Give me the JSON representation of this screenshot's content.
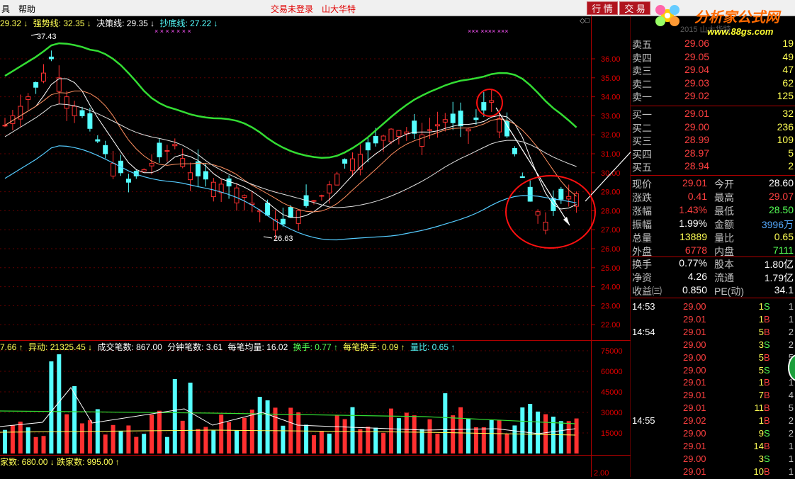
{
  "menubar": {
    "items": [
      "具",
      "帮助"
    ],
    "status_left": "交易未登录",
    "status_right": "山大华特",
    "buttons": [
      "行 情",
      "交 易"
    ]
  },
  "logo": {
    "title": "分析家公式网",
    "url": "www.88gs.com",
    "faded": "2015 山大华特"
  },
  "main_header": {
    "first": "29.32 ↓",
    "strong_label": "强势线: 32.35 ↓",
    "decide_label": "决策线: 29.35 ↓",
    "bottom_label": "抄底线: 27.22 ↓"
  },
  "price_axis": [
    "36.00",
    "35.00",
    "34.00",
    "33.00",
    "32.00",
    "31.00",
    "30.00",
    "29.00",
    "28.00",
    "27.00",
    "26.00",
    "25.00",
    "24.00",
    "23.00",
    "22.00"
  ],
  "price_marks": {
    "high": "37.43",
    "low": "26.63"
  },
  "volume_header": {
    "first": "7.66 ↑",
    "yidong": "异动: 21325.45 ↓",
    "trades": "成交笔数: 867.00",
    "per_min": "分钟笔数: 3.61",
    "avg": "每笔均量: 16.02",
    "turnover": "换手: 0.77 ↑",
    "per_turnover": "每笔换手: 0.09 ↑",
    "ratio": "量比: 0.65 ↑"
  },
  "volume_axis": [
    "75000",
    "60000",
    "45000",
    "30000",
    "15000"
  ],
  "bottom_header": {
    "up": "家数: 680.00 ↓",
    "down": "跌家数: 995.00 ↑"
  },
  "bottom_axis": "2.00",
  "order_book": {
    "sell": [
      {
        "label": "卖五",
        "price": "29.06",
        "vol": "19"
      },
      {
        "label": "卖四",
        "price": "29.05",
        "vol": "49"
      },
      {
        "label": "卖三",
        "price": "29.04",
        "vol": "47"
      },
      {
        "label": "卖二",
        "price": "29.03",
        "vol": "62"
      },
      {
        "label": "卖一",
        "price": "29.02",
        "vol": "125"
      }
    ],
    "buy": [
      {
        "label": "买一",
        "price": "29.01",
        "vol": "32"
      },
      {
        "label": "买二",
        "price": "29.00",
        "vol": "236"
      },
      {
        "label": "买三",
        "price": "28.99",
        "vol": "109"
      },
      {
        "label": "买四",
        "price": "28.97",
        "vol": "5"
      },
      {
        "label": "买五",
        "price": "28.94",
        "vol": "2"
      }
    ]
  },
  "stats": [
    {
      "l1": "现价",
      "v1": "29.01",
      "l2": "今开",
      "v2": "28.60",
      "c1": "#ff4040",
      "c2": "#ffffff"
    },
    {
      "l1": "涨跌",
      "v1": "0.41",
      "l2": "最高",
      "v2": "29.07",
      "c1": "#ff4040",
      "c2": "#ff4040"
    },
    {
      "l1": "涨幅",
      "v1": "1.43%",
      "l2": "最低",
      "v2": "28.50",
      "c1": "#ff4040",
      "c2": "#55ff55"
    },
    {
      "l1": "振幅",
      "v1": "1.99%",
      "l2": "金额",
      "v2": "3996万",
      "c1": "#ffffff",
      "c2": "#55aaff"
    },
    {
      "l1": "总量",
      "v1": "13889",
      "l2": "量比",
      "v2": "0.65",
      "c1": "#ffff55",
      "c2": "#ffff55"
    },
    {
      "l1": "外盘",
      "v1": "6778",
      "l2": "内盘",
      "v2": "7111",
      "c1": "#ff4040",
      "c2": "#55ff55"
    },
    {
      "l1": "换手",
      "v1": "0.77%",
      "l2": "股本",
      "v2": "1.80亿",
      "c1": "#ffffff",
      "c2": "#ffffff"
    },
    {
      "l1": "净资",
      "v1": "4.26",
      "l2": "流通",
      "v2": "1.79亿",
      "c1": "#ffffff",
      "c2": "#ffffff"
    },
    {
      "l1": "收益㈢",
      "v1": "0.850",
      "l2": "PE(动)",
      "v2": "34.1",
      "c1": "#ffffff",
      "c2": "#ffffff"
    }
  ],
  "ticks": [
    {
      "time": "14:53",
      "price": "29.00",
      "vol": "1",
      "side": "S",
      "n": "1"
    },
    {
      "time": "",
      "price": "29.01",
      "vol": "1",
      "side": "B",
      "n": "1"
    },
    {
      "time": "14:54",
      "price": "29.01",
      "vol": "5",
      "side": "B",
      "n": "2"
    },
    {
      "time": "",
      "price": "29.00",
      "vol": "3",
      "side": "S",
      "n": "2"
    },
    {
      "time": "",
      "price": "29.00",
      "vol": "5",
      "side": "B",
      "n": "5"
    },
    {
      "time": "",
      "price": "29.00",
      "vol": "5",
      "side": "S",
      "n": "1"
    },
    {
      "time": "",
      "price": "29.01",
      "vol": "1",
      "side": "B",
      "n": "1"
    },
    {
      "time": "",
      "price": "29.01",
      "vol": "7",
      "side": "B",
      "n": "4"
    },
    {
      "time": "",
      "price": "29.01",
      "vol": "11",
      "side": "B",
      "n": "5"
    },
    {
      "time": "14:55",
      "price": "29.02",
      "vol": "1",
      "side": "B",
      "n": "2"
    },
    {
      "time": "",
      "price": "29.00",
      "vol": "9",
      "side": "S",
      "n": "2"
    },
    {
      "time": "",
      "price": "29.01",
      "vol": "14",
      "side": "B",
      "n": "1"
    },
    {
      "time": "",
      "price": "29.00",
      "vol": "3",
      "side": "S",
      "n": "1"
    },
    {
      "time": "",
      "price": "29.01",
      "vol": "10",
      "side": "B",
      "n": "1"
    }
  ]
}
